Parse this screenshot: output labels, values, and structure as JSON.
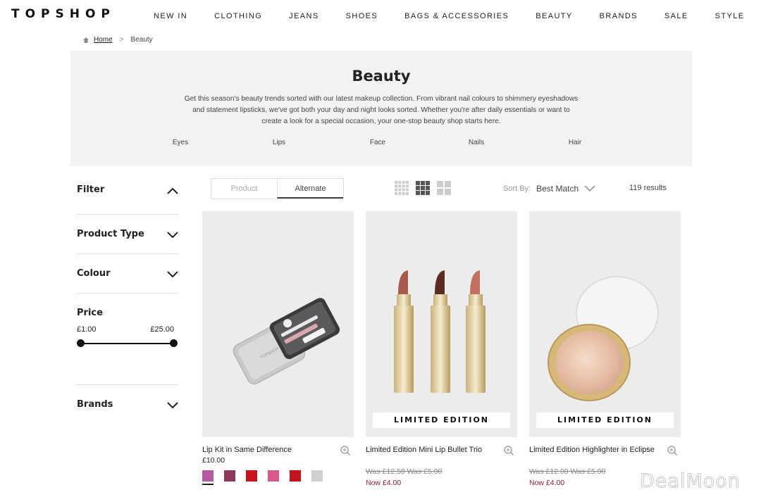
{
  "header": {
    "logo": "TOPSHOP",
    "nav": [
      "NEW IN",
      "CLOTHING",
      "JEANS",
      "SHOES",
      "BAGS & ACCESSORIES",
      "BEAUTY",
      "BRANDS",
      "SALE",
      "STYLE"
    ]
  },
  "breadcrumb": {
    "home": "Home",
    "separator": ">",
    "current": "Beauty"
  },
  "hero": {
    "title": "Beauty",
    "description": "Get this season's beauty trends sorted with our latest makeup collection. From vibrant nail colours to shimmery eyeshadows and statement lipsticks, we've got both your day and night looks sorted. Whether you're after daily essentials or want to create a look for a special occasion, your one-stop beauty shop starts here.",
    "links": [
      "Eyes",
      "Lips",
      "Face",
      "Nails",
      "Hair"
    ]
  },
  "filters": {
    "filter_label": "Filter",
    "product_type": "Product Type",
    "colour": "Colour",
    "price_label": "Price",
    "price_min": "£1.00",
    "price_max": "£25.00",
    "brands": "Brands"
  },
  "toolbar": {
    "view_product": "Product",
    "view_alternate": "Alternate",
    "sort_label": "Sort By:",
    "sort_value": "Best Match",
    "results": "119 results"
  },
  "products": [
    {
      "name": "Lip Kit in Same Difference",
      "price": "£10.00",
      "swatches": [
        "#b55aa0",
        "#8b3a5a",
        "#c8141e",
        "#d75a8c",
        "#c0141e",
        "#d0d0d0"
      ]
    },
    {
      "name": "Limited Edition Mini Lip Bullet Trio",
      "badge": "LIMITED EDITION",
      "was": "Was £12.50 Was £5.00",
      "now": "Now £4.00"
    },
    {
      "name": "Limited Edition Highlighter in Eclipse",
      "badge": "LIMITED EDITION",
      "was": "Was £12.00 Was £5.00",
      "now": "Now £4.00"
    }
  ],
  "watermark": "DealMoon"
}
